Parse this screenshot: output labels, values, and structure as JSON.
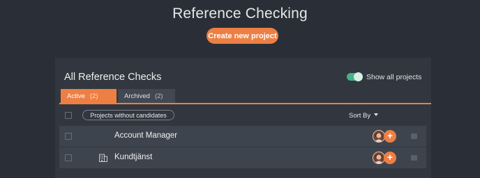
{
  "page": {
    "title": "Reference Checking",
    "create_button": "Create new project"
  },
  "panel": {
    "title": "All Reference Checks",
    "show_all_toggle": {
      "label": "Show all projects",
      "on": true
    },
    "tabs": [
      {
        "label": "Active",
        "count": "(2)",
        "selected": true
      },
      {
        "label": "Archived",
        "count": "(2)",
        "selected": false
      }
    ],
    "filter_pill": "Projects without candidates",
    "sort_by": "Sort By",
    "rows": [
      {
        "name": "Account Manager",
        "icon": null
      },
      {
        "name": "Kundtjänst",
        "icon": "building-icon"
      }
    ]
  },
  "colors": {
    "accent": "#ee7f43",
    "toggle_on": "#46b08a",
    "background": "#2a2f37",
    "panel": "#32373f",
    "row": "#3e444d"
  }
}
